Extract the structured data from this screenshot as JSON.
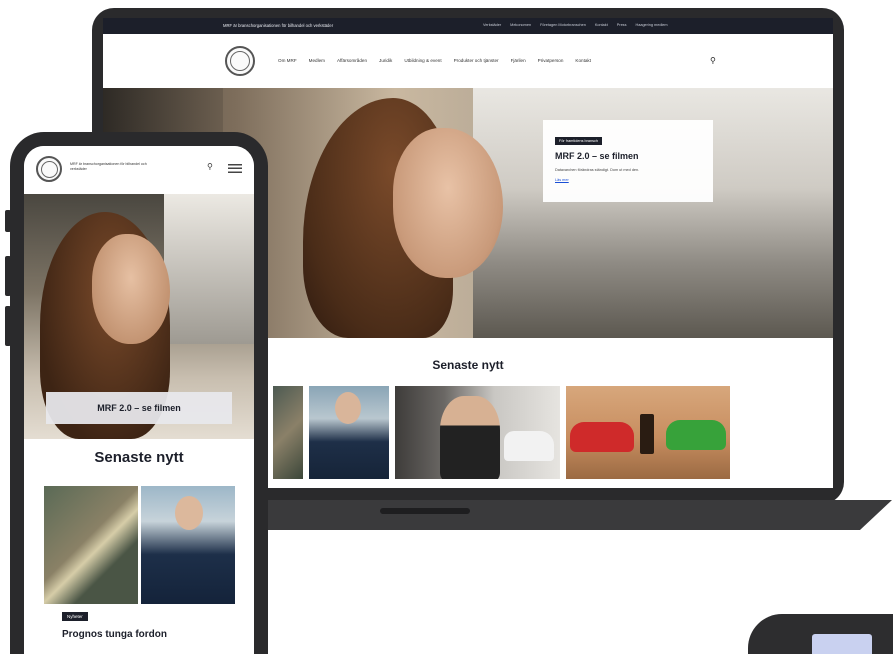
{
  "laptop": {
    "topbar": {
      "org_name": "MRF är branschorganisationen för bilhandel och verkstäder",
      "links": [
        "Verkstäder",
        "Mekonomen",
        "Företagen Motorbranschen",
        "Kontakt",
        "Press",
        "Haagering medlem"
      ]
    },
    "nav": {
      "items": [
        "Om MRF",
        "Medlem",
        "Affärsområden",
        "Juridik",
        "Utbildning & event",
        "Produkter och tjänster",
        "Fjärilen",
        "Privatperson",
        "Kontakt"
      ],
      "search_icon": "search-icon"
    },
    "hero": {
      "tag": "För framtidens bransch",
      "title": "MRF 2.0 – se filmen",
      "description": "Datavarchen förändras ständigt. Dom ut med den.",
      "link": "Läs mer"
    },
    "news": {
      "heading": "Senaste nytt"
    }
  },
  "phone": {
    "header": {
      "org_name": "MRF är branschorganisationen för bilhandel och verkstäder",
      "search_icon": "search-icon",
      "menu_icon": "hamburger-menu-icon"
    },
    "hero": {
      "button": "MRF 2.0 – se filmen"
    },
    "news": {
      "heading": "Senaste nytt",
      "article_tag": "Nyheter",
      "article_title": "Prognos tunga fordon"
    }
  }
}
